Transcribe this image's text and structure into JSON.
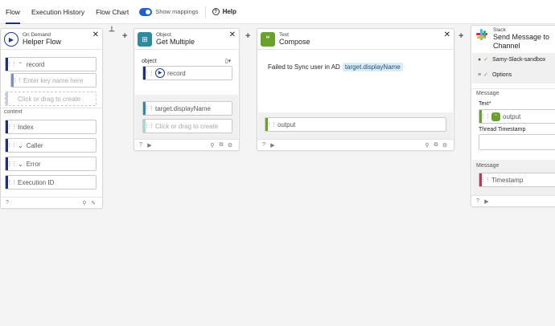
{
  "topbar": {
    "tabs": [
      {
        "label": "Flow",
        "active": true
      },
      {
        "label": "Execution History"
      },
      {
        "label": "Flow Chart"
      }
    ],
    "mappings_toggle_label": "Show mappings",
    "help_label": "Help"
  },
  "helper_card": {
    "type": "On Demand",
    "title": "Helper Flow",
    "record_label": "record",
    "key_placeholder": "Enter key name here",
    "create_placeholder": "Click or drag to create",
    "context_label": "context",
    "context_items": [
      "Index",
      "Caller",
      "Error",
      "Execution ID"
    ]
  },
  "object_card": {
    "type": "Object",
    "title": "Get Multiple",
    "object_label": "object",
    "record_label": "record",
    "target_label": "target.displayName",
    "create_placeholder": "Click or drag to create"
  },
  "text_card": {
    "type": "Text",
    "title": "Compose",
    "body_text": "Failed to Sync user in AD",
    "chip_label": "target.displayName",
    "output_label": "output"
  },
  "slack_card": {
    "type": "Slack",
    "title_line1": "Send Message to",
    "title_line2": "Channel",
    "account_label": "Samy-Slack-sandbox",
    "options_label": "Options",
    "message_section": "Message",
    "text_label": "Text*",
    "text_value": "output",
    "thread_label": "Thread Timestamp",
    "message_section2": "Message",
    "timestamp_label": "Timestamp"
  },
  "colors": {
    "accent": "#1d2f7a",
    "object_teal": "#2f8aa0",
    "text_green": "#6aa12e",
    "timestamp_red": "#c8324f"
  }
}
